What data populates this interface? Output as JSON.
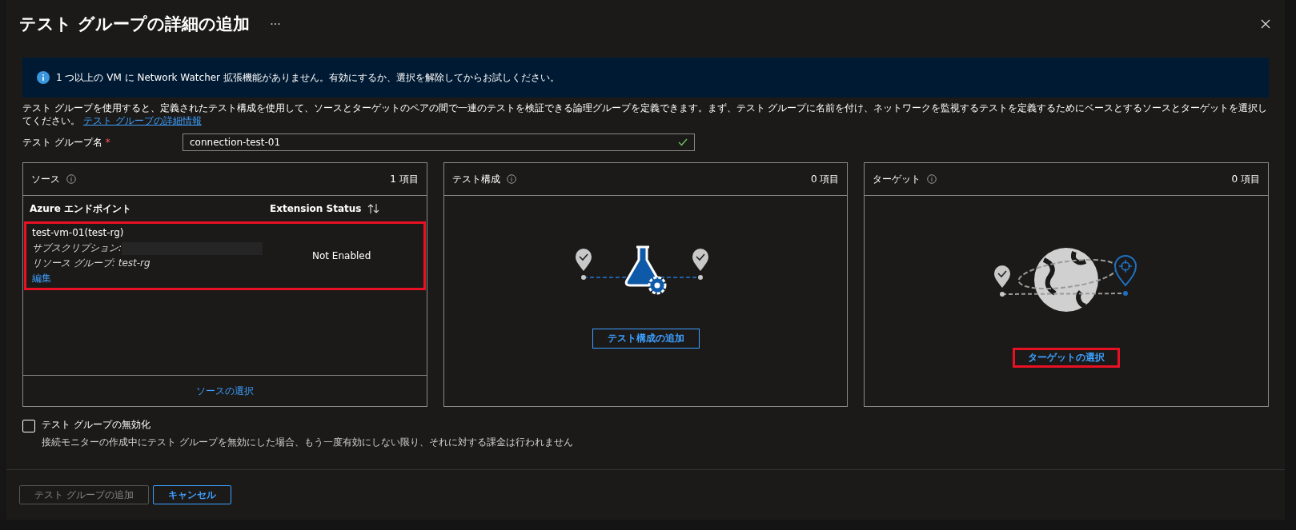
{
  "dialog": {
    "title": "テスト グループの詳細の追加"
  },
  "banner": {
    "text": "1 つ以上の VM に Network Watcher 拡張機能がありません。有効にするか、選択を解除してからお試しください。"
  },
  "description": {
    "text": "テスト グループを使用すると、定義されたテスト構成を使用して、ソースとターゲットのペアの間で一連のテストを検証できる論理グループを定義できます。まず、テスト グループに名前を付け、ネットワークを監視するテストを定義するためにベースとするソースとターゲットを選択してください。",
    "link": "テスト グループの詳細情報"
  },
  "name_field": {
    "label": "テスト グループ名",
    "required_mark": "*",
    "value": "connection-test-01",
    "valid": true
  },
  "panels": [
    {
      "kind": "table",
      "title": "ソース",
      "count": "1 項目",
      "columns": [
        "Azure エンドポイント",
        "Extension Status"
      ],
      "rows": [
        {
          "name": "test-vm-01(test-rg)",
          "subscription_label": "サブスクリプション:",
          "resource_group": "リソース グループ: test-rg",
          "edit": "編集",
          "status": "Not Enabled",
          "highlighted": true
        }
      ],
      "action": {
        "label": "ソースの選択"
      }
    },
    {
      "kind": "config",
      "title": "テスト構成",
      "count": "0 項目",
      "action": {
        "label": "テスト構成の追加",
        "highlighted": false
      }
    },
    {
      "kind": "target",
      "title": "ターゲット",
      "count": "0 項目",
      "action": {
        "label": "ターゲットの選択",
        "highlighted": true
      }
    }
  ],
  "disable_option": {
    "label": "テスト グループの無効化",
    "checked": false,
    "hint": "接続モニターの作成中にテスト グループを無効にした場合、もう一度有効にしない限り、それに対する課金は行われません"
  },
  "buttons": [
    {
      "label": "テスト グループの追加",
      "disabled": true
    },
    {
      "label": "キャンセル",
      "disabled": false
    }
  ]
}
